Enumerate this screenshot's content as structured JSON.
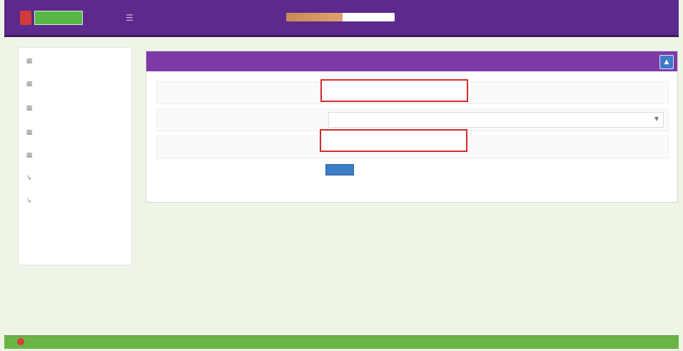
{
  "header": {
    "brand_text": "",
    "brand_pill": "",
    "menu_icon": "menu-icon",
    "center_title": "",
    "progress_fraction": 0.52,
    "user_label": ""
  },
  "sidebar": {
    "items": [
      {
        "icon": "dashboard-icon",
        "label": ""
      },
      {
        "icon": "document-icon",
        "label": ""
      },
      {
        "icon": "list-icon",
        "label": ""
      },
      {
        "icon": "user-icon",
        "label": ""
      },
      {
        "icon": "settings-icon",
        "label": ""
      },
      {
        "icon": "link-icon",
        "label": ""
      },
      {
        "icon": "link-icon",
        "label": ""
      }
    ]
  },
  "panel": {
    "title": "",
    "toggle_icon": "collapse-icon",
    "rows": [
      {
        "label": "",
        "value": "",
        "placeholder": ""
      },
      {
        "label": "",
        "select_value": ""
      },
      {
        "label": "",
        "value": "",
        "placeholder": ""
      }
    ],
    "submit_label": ""
  },
  "footer": {
    "left_text": "",
    "right_text": "",
    "right_link": ""
  },
  "colors": {
    "header_purple": "#5b2a8c",
    "panel_header_purple": "#7d3aa6",
    "footer_green": "#6ab446",
    "highlight_red": "#d02c2c",
    "button_blue": "#3b7fc4"
  }
}
